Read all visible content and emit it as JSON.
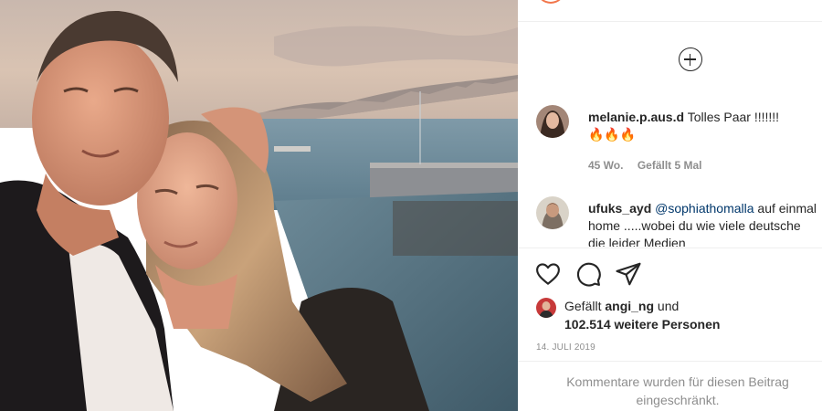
{
  "photo": {
    "icon": "post-photo"
  },
  "comments": [
    {
      "username": "melanie.p.aus.d",
      "text": "Tolles Paar !!!!!!!",
      "emoji": "🔥🔥🔥",
      "age": "45 Wo.",
      "likes": "Gefällt 5 Mal"
    },
    {
      "username": "ufuks_ayd",
      "mention": "@sophiathomalla",
      "text": "auf einmal home .....wobei du wie viele deutsche die leider Medien"
    }
  ],
  "actions": {
    "icons": [
      "heart-icon",
      "comment-icon",
      "share-icon"
    ]
  },
  "likes": {
    "prefix": "Gefällt",
    "user": "angi_ng",
    "conjunction": "und",
    "count_text": "102.514 weitere Personen"
  },
  "date": "14. JULI 2019",
  "comments_restricted": "Kommentare wurden für diesen Beitrag eingeschränkt.",
  "colors": {
    "text": "#262626",
    "secondary": "#8e8e8e",
    "mention": "#00376b",
    "separator": "#efefef"
  }
}
